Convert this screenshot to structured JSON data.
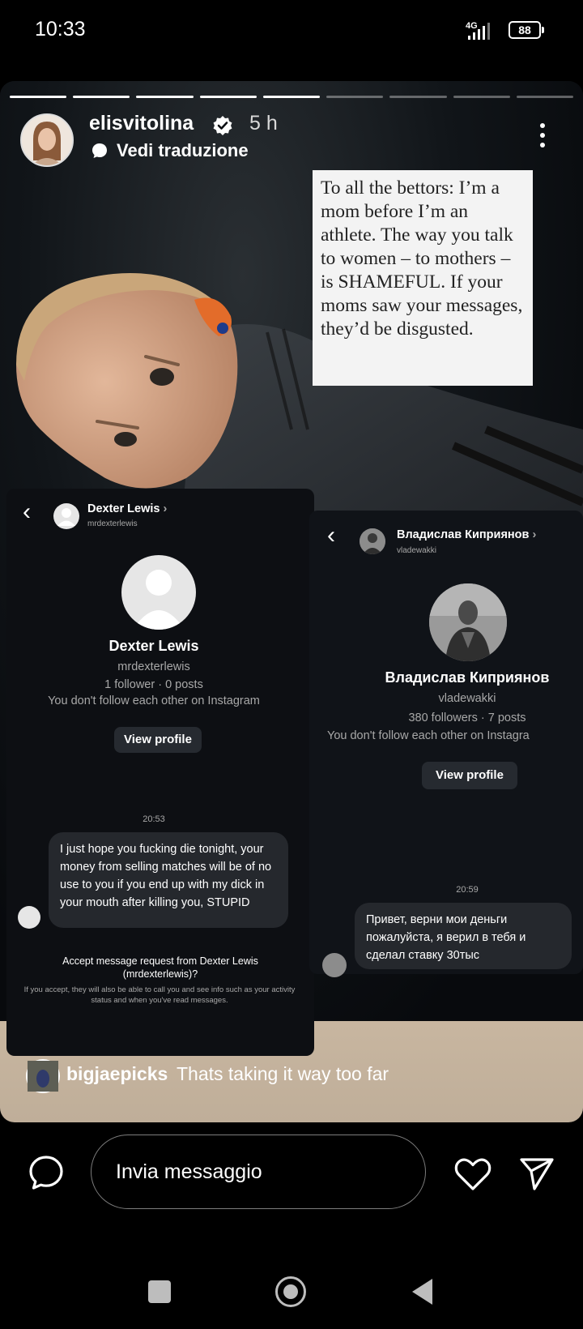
{
  "status_bar": {
    "time": "10:33",
    "network": "4G",
    "battery": "88"
  },
  "story": {
    "progress_total": 9,
    "progress_done": 5,
    "username": "elisvitolina",
    "time_ago": "5 h",
    "translate_label": "Vedi traduzione",
    "quote": "To all the bettors: I’m a mom before I’m an athlete. The way you talk to women – to mothers – is SHAMEFUL. If your moms saw your messages, they’d be disgusted."
  },
  "dm_left": {
    "name": "Dexter Lewis",
    "handle": "mrdexterlewis",
    "chevron": "›",
    "profile_name": "Dexter Lewis",
    "profile_handle": "mrdexterlewis",
    "stats": "1 follower · 0 posts",
    "follow_note": "You don't follow each other on Instagram",
    "view_profile": "View profile",
    "time": "20:53",
    "message": "I just hope you fucking die tonight, your money from selling matches will be of no use to you if you end up with my dick in your mouth after killing you, STUPID",
    "request_title": "Accept message request from Dexter Lewis (mrdexterlewis)?",
    "request_note": "If you accept, they will also be able to call you and see info such as your activity status and when you've read messages."
  },
  "dm_right": {
    "name": "Владислав Киприянов",
    "handle": "vladewakki",
    "chevron": "›",
    "profile_name": "Владислав Киприянов",
    "profile_handle": "vladewakki",
    "stats": "380 followers · 7 posts",
    "follow_note": "You don't follow each other on Instagra",
    "view_profile": "View profile",
    "time": "20:59",
    "message": "Привет, верни мои деньги пожалуйста, я верил в тебя и сделал ставку 30тыс"
  },
  "comment": {
    "user": "bigjaepicks",
    "text": "Thats taking it way too far"
  },
  "reply_bar": {
    "placeholder": "Invia messaggio"
  },
  "colors": {
    "story_bg": "#0b0e12",
    "card": "#0d0f13",
    "bubble": "#25282d",
    "beige": "#c8b6a0"
  }
}
